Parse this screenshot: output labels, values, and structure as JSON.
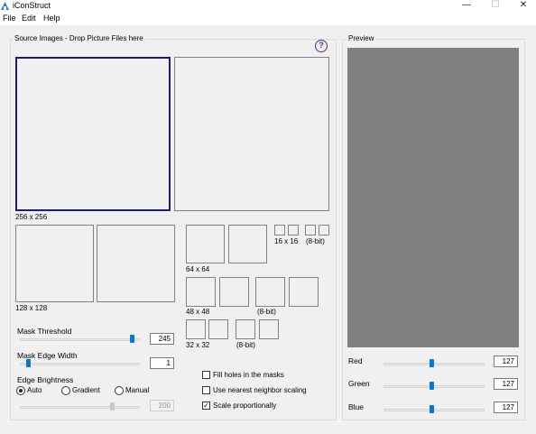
{
  "window": {
    "title": "iConStruct",
    "min": "—",
    "max": "☐",
    "close": "✕"
  },
  "menu": [
    "File",
    "Edit",
    "Help"
  ],
  "source": {
    "title": "Source Images - Drop Picture Files here",
    "help": "?",
    "labels": {
      "s256": "256 x 256",
      "s128": "128 x 128",
      "s64": "64 x 64",
      "s48": "48 x 48",
      "s32": "32 x 32",
      "s16": "16 x 16",
      "bit8": "(8-bit)"
    }
  },
  "controls": {
    "mask_threshold": {
      "label": "Mask Threshold",
      "value": "245",
      "level": 0.96
    },
    "mask_edge_width": {
      "label": "Mask Edge Width",
      "value": "1",
      "level": 0.0
    },
    "edge_brightness": {
      "label": "Edge Brightness",
      "options": [
        "Auto",
        "Gradient",
        "Manual"
      ],
      "selected": "Auto",
      "value": "200",
      "level": 0.78
    },
    "fill_holes": {
      "label": "Fill holes in the masks",
      "checked": false
    },
    "nearest_neighbor": {
      "label": "Use nearest neighbor scaling",
      "checked": false
    },
    "scale_prop": {
      "label": "Scale proportionally",
      "checked": true,
      "mark": "✓"
    }
  },
  "preview": {
    "title": "Preview",
    "background": "#808080",
    "red": {
      "label": "Red",
      "value": "127",
      "level": 0.5
    },
    "green": {
      "label": "Green",
      "value": "127",
      "level": 0.5
    },
    "blue": {
      "label": "Blue",
      "value": "127",
      "level": 0.5
    }
  },
  "accent": "#0078d7"
}
